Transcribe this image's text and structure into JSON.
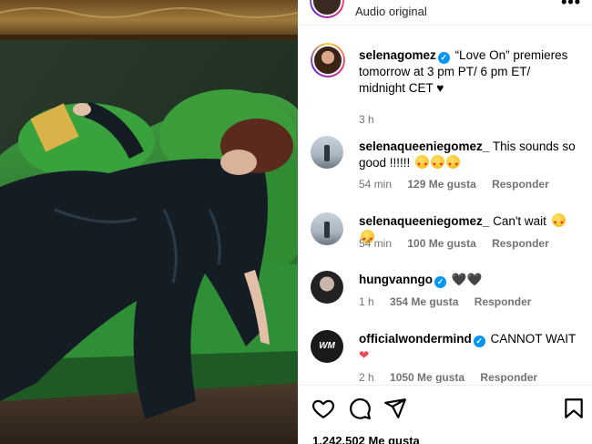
{
  "header": {
    "audio_label": "Audio original",
    "more_label": "•••"
  },
  "caption": {
    "username": "selenagomez",
    "text": "“Love On” premieres tomorrow at 3 pm PT/ 6 pm ET/ midnight CET ♥",
    "time": "3 h"
  },
  "comments": [
    {
      "username": "selenaqueeniegomez_",
      "text": "This sounds so good !!!!!!",
      "time": "54 min",
      "likes": "129 Me gusta",
      "reply": "Responder"
    },
    {
      "username": "selenaqueeniegomez_",
      "text": "Can't wait",
      "time": "54 min",
      "likes": "100 Me gusta",
      "reply": "Responder"
    },
    {
      "username": "hungvanngo",
      "text": "🖤🖤",
      "time": "1 h",
      "likes": "354 Me gusta",
      "reply": "Responder"
    },
    {
      "username": "officialwondermind",
      "text": "CANNOT WAIT",
      "heart": "❤",
      "time": "2 h",
      "likes": "1050 Me gusta",
      "reply": "Responder",
      "avatar_text": "WM"
    }
  ],
  "footer": {
    "likes_count": "1.242.502 Me gusta"
  },
  "colors": {
    "verified": "#0095f6",
    "muted": "#737373",
    "heart": "#ed4956"
  }
}
